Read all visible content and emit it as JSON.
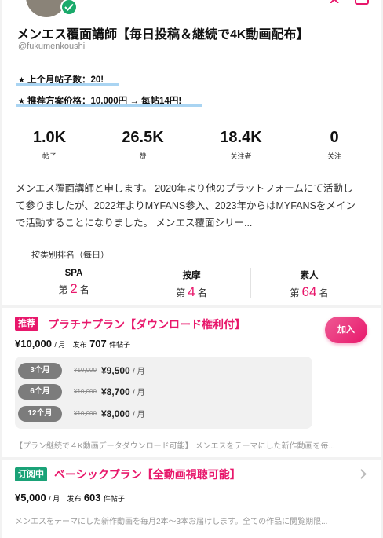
{
  "profile": {
    "name": "メンエス覆面講師【毎日投稿＆継続で4K動画配布】",
    "handle": "@fukumenkoushi",
    "highlight1": "上个月帖子数：20!",
    "highlight2": "推荐方案价格：10,000円 → 每帖14円!",
    "star": "★",
    "stats": [
      {
        "value": "1.0K",
        "label": "帖子"
      },
      {
        "value": "26.5K",
        "label": "赞"
      },
      {
        "value": "18.4K",
        "label": "关注者"
      },
      {
        "value": "0",
        "label": "关注"
      }
    ],
    "bio": "メンエス覆面講師と申します。 2020年より他のプラットフォームにて活動して参りましたが、2022年よりMYFANS参入、2023年からはMYFANSをメインで活動することになりました。 メンエス覆面シリー...",
    "ranking": {
      "title": "按类别排名（每日）",
      "prefix": "第",
      "suffix": "名",
      "items": [
        {
          "category": "SPA",
          "rank": "2"
        },
        {
          "category": "按摩",
          "rank": "4"
        },
        {
          "category": "素人",
          "rank": "64"
        }
      ]
    }
  },
  "plan1": {
    "badge": "推荐",
    "title": "プラチナプラン【ダウンロード権利付】",
    "price": "¥10,000",
    "per": "/ 月",
    "posts_label": "发布",
    "posts": "707",
    "posts_unit": "件帖子",
    "join": "加入",
    "options": [
      {
        "duration": "3个月",
        "old": "¥10,000",
        "new": "¥9,500",
        "unit": "/ 月"
      },
      {
        "duration": "6个月",
        "old": "¥10,000",
        "new": "¥8,700",
        "unit": "/ 月"
      },
      {
        "duration": "12个月",
        "old": "¥10,000",
        "new": "¥8,000",
        "unit": "/ 月"
      }
    ],
    "description": "【プラン継続で４K動画データダウンロード可能】 メンエスをテーマにした新作動画を毎..."
  },
  "plan2": {
    "badge": "订阅中",
    "title": "ベーシックプラン【全動画視聴可能】",
    "price": "¥5,000",
    "per": "/ 月",
    "posts_label": "发布",
    "posts": "603",
    "posts_unit": "件帖子",
    "description": "メンエスをテーマにした新作動画を毎月2本〜3本お届けします。全ての作品に閲覧期限..."
  },
  "colors": {
    "accent": "#e8176b",
    "subscribed": "#1aa277",
    "highlight_underline": "#a9d4f2"
  }
}
